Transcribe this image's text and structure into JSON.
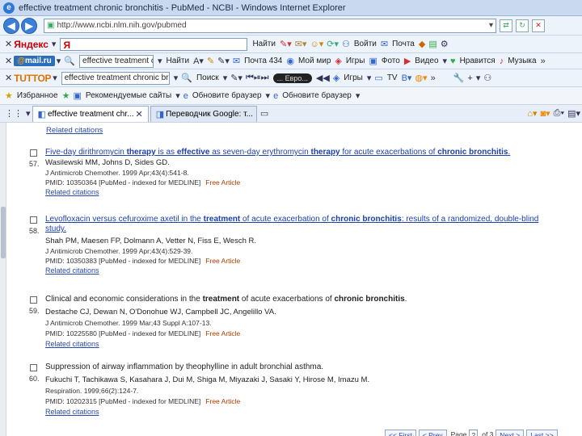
{
  "window": {
    "title": "effective treatment chronic bronchitis - PubMed - NCBI - Windows Internet Explorer",
    "url": "http://www.ncbi.nlm.nih.gov/pubmed"
  },
  "toolbars": {
    "yandex": {
      "logo": "Яндекс",
      "input_logo": "Я",
      "find": "Найти",
      "login": "Войти",
      "mail": "Почта"
    },
    "mailru": {
      "logo_at": "@",
      "logo_text": "mail.ru",
      "search_value": "effective treatment chron",
      "find": "Найти",
      "mail": "Почта 434",
      "my_world": "Мой мир",
      "games": "Игры",
      "photo": "Фото",
      "video": "Видео",
      "liked": "Нравится",
      "music": "Музыка"
    },
    "tuttop": {
      "logo": "TUTTOP",
      "search_value": "effective treatment chronic bronc",
      "search": "Поиск",
      "radio_text": "... Евро...",
      "games": "Игры",
      "tv": "TV"
    }
  },
  "favorites": {
    "label": "Избранное",
    "items": [
      "Рекомендуемые сайты",
      "Обновите браузер",
      "Обновите браузер"
    ]
  },
  "tabs": [
    {
      "label": "effective treatment chr..."
    },
    {
      "label": "Переводчик Google: т..."
    }
  ],
  "results": {
    "top_related": "Related citations",
    "items": [
      {
        "number": "57.",
        "title_parts": [
          "Five-day dirithromycin ",
          "therapy",
          " is as ",
          "effective",
          " as seven-day erythromycin ",
          "therapy",
          " for acute exacerbations of ",
          "chronic bronchitis",
          "."
        ],
        "authors": "Wasilewski MM, Johns D, Sides GD.",
        "journal": "J Antimicrob Chemother. 1999 Apr;43(4):541-8.",
        "pmid": "PMID: 10350364 [PubMed - indexed for MEDLINE]",
        "free": "Free Article",
        "related": "Related citations"
      },
      {
        "number": "58.",
        "title_parts": [
          "Levofloxacin versus cefuroxime axetil in the ",
          "treatment",
          " of acute exacerbation of ",
          "chronic bronchitis",
          ": results of a randomized, double-blind study."
        ],
        "authors": "Shah PM, Maesen FP, Dolmann A, Vetter N, Fiss E, Wesch R.",
        "journal": "J Antimicrob Chemother. 1999 Apr;43(4):529-39.",
        "pmid": "PMID: 10350383 [PubMed - indexed for MEDLINE]",
        "free": "Free Article",
        "related": "Related citations"
      },
      {
        "number": "59.",
        "title_parts": [
          "Clinical and economic considerations in the ",
          "treatment",
          " of acute exacerbations of ",
          "chronic bronchitis",
          "."
        ],
        "authors": "Destache CJ, Dewan N, O'Donohue WJ, Campbell JC, Angelillo VA.",
        "journal": "J Antimicrob Chemother. 1999 Mar;43 Suppl A:107-13.",
        "pmid": "PMID: 10225580 [PubMed - indexed for MEDLINE]",
        "free": "Free Article",
        "related": "Related citations"
      },
      {
        "number": "60.",
        "title": "Suppression of airway inflammation by theophylline in adult bronchial asthma.",
        "authors": "Fukuchi T, Tachikawa S, Kasahara J, Dui M, Shiga M, Miyazaki J, Sasaki Y, Hirose M, Imazu M.",
        "journal": "Respiration. 1999;66(2):124-7.",
        "pmid": "PMID: 10202315 [PubMed - indexed for MEDLINE]",
        "free": "Free Article",
        "related": "Related citations"
      }
    ]
  },
  "pager": {
    "first": "<< First",
    "prev": "< Prev",
    "page_label": "Page",
    "page": "2",
    "of": "of 3",
    "next": "Next >",
    "last": "Last >>"
  }
}
